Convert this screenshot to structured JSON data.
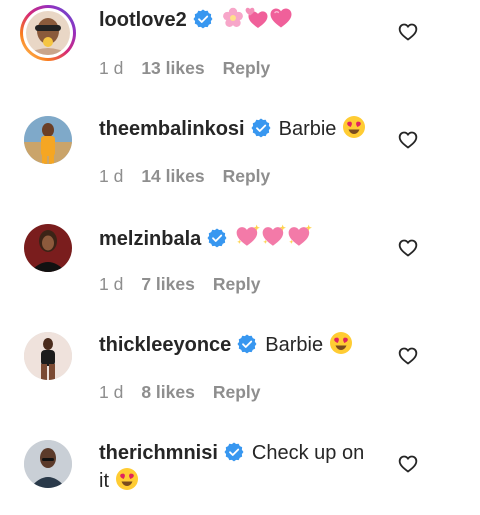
{
  "comments": [
    {
      "username": "lootlove2",
      "text": "",
      "emojis": [
        "flower-emoji",
        "two-hearts-emoji",
        "pink-heart-emoji"
      ],
      "time": "1 d",
      "likes": "13 likes",
      "reply": "Reply"
    },
    {
      "username": "theembalinkosi",
      "text": "Barbie",
      "emojis": [
        "heart-eyes-emoji"
      ],
      "time": "1 d",
      "likes": "14 likes",
      "reply": "Reply"
    },
    {
      "username": "melzinbala",
      "text": "",
      "emojis": [
        "sparkling-hearts-emoji",
        "sparkling-hearts-emoji",
        "sparkling-hearts-emoji"
      ],
      "time": "1 d",
      "likes": "7 likes",
      "reply": "Reply"
    },
    {
      "username": "thickleeyonce",
      "text": "Barbie",
      "emojis": [
        "heart-eyes-emoji"
      ],
      "time": "1 d",
      "likes": "8 likes",
      "reply": "Reply"
    },
    {
      "username": "therichmnisi",
      "text": "Check up on",
      "text_line2": "it",
      "emojis": [
        "heart-eyes-emoji"
      ]
    }
  ],
  "colors": {
    "verified": "#3897f0",
    "meta": "#8e8e8e",
    "text": "#262626"
  }
}
